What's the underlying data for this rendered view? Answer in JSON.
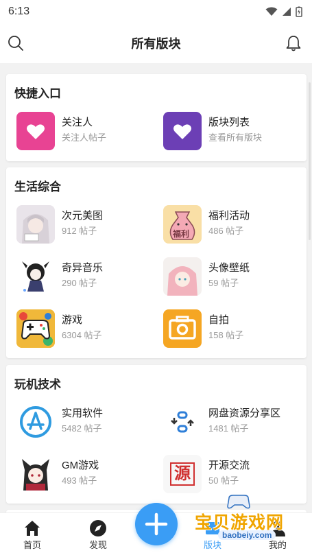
{
  "status": {
    "time": "6:13"
  },
  "header": {
    "title": "所有版块",
    "search_icon": "search-icon",
    "bell_icon": "bell-icon"
  },
  "quick": {
    "title": "快捷入口",
    "items": [
      {
        "name": "关注人",
        "sub": "关注人帖子",
        "color": "#e84393",
        "icon": "heart-icon"
      },
      {
        "name": "版块列表",
        "sub": "查看所有版块",
        "color": "#6c3fb5",
        "icon": "heart-icon"
      }
    ]
  },
  "life": {
    "title": "生活综合",
    "items": [
      {
        "name": "次元美图",
        "sub": "912 帖子"
      },
      {
        "name": "福利活动",
        "sub": "486 帖子",
        "thumb_text": "福利"
      },
      {
        "name": "奇异音乐",
        "sub": "290 帖子"
      },
      {
        "name": "头像壁纸",
        "sub": "59 帖子"
      },
      {
        "name": "游戏",
        "sub": "6304 帖子"
      },
      {
        "name": "自拍",
        "sub": "158 帖子"
      }
    ]
  },
  "tech": {
    "title": "玩机技术",
    "items": [
      {
        "name": "实用软件",
        "sub": "5482 帖子"
      },
      {
        "name": "网盘资源分享区",
        "sub": "1481 帖子"
      },
      {
        "name": "GM游戏",
        "sub": "493 帖子"
      },
      {
        "name": "开源交流",
        "sub": "50 帖子",
        "thumb_text": "源"
      }
    ]
  },
  "tabs": [
    {
      "label": "首页",
      "icon": "home-icon"
    },
    {
      "label": "发现",
      "icon": "compass-icon"
    },
    {
      "label": "版块",
      "icon": "board-icon"
    },
    {
      "label": "我的",
      "icon": "profile-icon"
    }
  ],
  "fab": {
    "icon": "plus-icon"
  },
  "watermark": {
    "text": "宝贝游戏网",
    "url": "baobeiy.com"
  },
  "colors": {
    "accent": "#3a9df5",
    "game_orange": "#f5a623"
  }
}
